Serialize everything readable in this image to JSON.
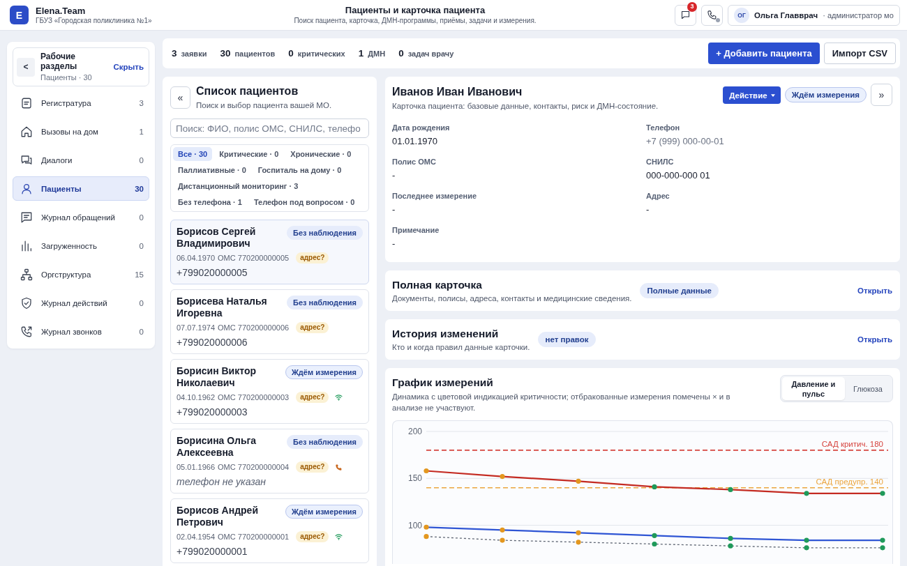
{
  "header": {
    "logo": "E",
    "brand": "Elena.Team",
    "organization": "ГБУЗ «Городская поликлиника №1»",
    "title": "Пациенты и карточка пациента",
    "subtitle": "Поиск пациента, карточка, ДМН-программы, приёмы, задачи и измерения.",
    "messages_badge": "3",
    "telephony_online": false,
    "user": {
      "initials": "ОГ",
      "name": "Ольга Главврач",
      "role": "· администратор мо"
    }
  },
  "sidebar": {
    "back_button": "<",
    "title": "Рабочие разделы",
    "subtitle": "Пациенты · 30",
    "hide_link": "Скрыть",
    "items": [
      {
        "label": "Регистратура",
        "count": "3",
        "selected": false
      },
      {
        "label": "Вызовы на дом",
        "count": "1",
        "selected": false
      },
      {
        "label": "Диалоги",
        "count": "0",
        "selected": false
      },
      {
        "label": "Пациенты",
        "count": "30",
        "selected": true
      },
      {
        "label": "Журнал обращений",
        "count": "0",
        "selected": false
      },
      {
        "label": "Загруженность",
        "count": "0",
        "selected": false
      },
      {
        "label": "Оргструктура",
        "count": "15",
        "selected": false
      },
      {
        "label": "Журнал действий",
        "count": "0",
        "selected": false
      },
      {
        "label": "Журнал звонков",
        "count": "0",
        "selected": false
      }
    ]
  },
  "stats": [
    {
      "count": "3",
      "label": "заявки"
    },
    {
      "count": "30",
      "label": "пациентов"
    },
    {
      "count": "0",
      "label": "критических"
    },
    {
      "count": "1",
      "label": "ДМН"
    },
    {
      "count": "0",
      "label": "задач врачу"
    }
  ],
  "actions": {
    "add_button": "+ Добавить пациента",
    "import_button": "Импорт CSV"
  },
  "patient_list": {
    "collapse_button": "«",
    "title": "Список пациентов",
    "subtitle": "Поиск и выбор пациента вашей МО.",
    "search": {
      "placeholder": "Поиск: ФИО, полис ОМС, СНИЛС, телефо"
    },
    "filters": [
      {
        "label": "Все · 30",
        "selected": true
      },
      {
        "label": "Критические · 0",
        "selected": false
      },
      {
        "label": "Хронические · 0",
        "selected": false
      },
      {
        "label": "Паллиативные · 0",
        "selected": false
      },
      {
        "label": "Госпиталь на дому · 0",
        "selected": false
      },
      {
        "label": "Дистанционный мониторинг · 3",
        "selected": false
      },
      {
        "label": "Без телефона · 1",
        "selected": false
      },
      {
        "label": "Телефон под вопросом · 0",
        "selected": false
      }
    ],
    "patients": [
      {
        "name": "Борисов Сергей Владимирович",
        "status": {
          "text": "Без наблюдения",
          "kind": "idle"
        },
        "birth_date": "06.04.1970",
        "policy": "ОМС 770200000005",
        "address_flag": "адрес?",
        "remote_monitoring": false,
        "phone_warning": false,
        "phone": "+799020000005",
        "phone_missing": false,
        "selected": true
      },
      {
        "name": "Борисева Наталья Игоревна",
        "status": {
          "text": "Без наблюдения",
          "kind": "idle"
        },
        "birth_date": "07.07.1974",
        "policy": "ОМС 770200000006",
        "address_flag": "адрес?",
        "remote_monitoring": false,
        "phone_warning": false,
        "phone": "+799020000006",
        "phone_missing": false,
        "selected": false
      },
      {
        "name": "Борисин Виктор Николаевич",
        "status": {
          "text": "Ждём измерения",
          "kind": "waiting"
        },
        "birth_date": "04.10.1962",
        "policy": "ОМС 770200000003",
        "address_flag": "адрес?",
        "remote_monitoring": true,
        "phone_warning": false,
        "phone": "+799020000003",
        "phone_missing": false,
        "selected": false
      },
      {
        "name": "Борисина Ольга Алексеевна",
        "status": {
          "text": "Без наблюдения",
          "kind": "idle"
        },
        "birth_date": "05.01.1966",
        "policy": "ОМС 770200000004",
        "address_flag": "адрес?",
        "remote_monitoring": false,
        "phone_warning": true,
        "phone": "телефон не указан",
        "phone_missing": true,
        "selected": false
      },
      {
        "name": "Борисов Андрей Петрович",
        "status": {
          "text": "Ждём измерения",
          "kind": "waiting"
        },
        "birth_date": "02.04.1954",
        "policy": "ОМС 770200000001",
        "address_flag": "адрес?",
        "remote_monitoring": true,
        "phone_warning": false,
        "phone": "+799020000001",
        "phone_missing": false,
        "selected": false
      }
    ]
  },
  "patient_card": {
    "name": "Иванов Иван Иванович",
    "subtitle": "Карточка пациента: базовые данные, контакты, риск и ДМН-состояние.",
    "action_button": "Действие",
    "status": {
      "text": "Ждём измерения",
      "kind": "waiting"
    },
    "expand_button": "»",
    "fields": [
      {
        "label": "Дата рождения",
        "value": "01.01.1970",
        "muted": false
      },
      {
        "label": "Телефон",
        "value": "+7 (999) 000-00-01",
        "muted": true
      },
      {
        "label": "Полис ОМС",
        "value": "-",
        "muted": false
      },
      {
        "label": "СНИЛС",
        "value": "000-000-000 01",
        "muted": false
      },
      {
        "label": "Последнее измерение",
        "value": "-",
        "muted": false
      },
      {
        "label": "Адрес",
        "value": "-",
        "muted": false
      },
      {
        "label": "Примечание",
        "value": "-",
        "muted": false
      }
    ]
  },
  "sections": [
    {
      "title": "Полная карточка",
      "subtitle": "Документы, полисы, адреса, контакты и медицинские сведения.",
      "badge": "Полные данные",
      "link": "Открыть"
    },
    {
      "title": "История изменений",
      "subtitle": "Кто и когда правил данные карточки.",
      "badge": "нет правок",
      "link": "Открыть"
    }
  ],
  "measurements": {
    "title": "График измерений",
    "subtitle": "Динамика с цветовой индикацией критичности; отбракованные измерения помечены × и в анализе не участвуют.",
    "tabs": [
      {
        "label": "Давление и пульс",
        "selected": true
      },
      {
        "label": "Глюкоза",
        "selected": false
      }
    ],
    "point_alerts": [
      [
        true,
        true,
        true,
        false,
        false,
        false,
        false
      ],
      [
        true,
        true,
        true,
        false,
        false,
        false,
        false
      ],
      [
        true,
        true,
        true,
        false,
        false,
        false,
        false
      ]
    ],
    "chart_data": {
      "type": "line",
      "ylim": [
        60,
        200
      ],
      "yticks": [
        100,
        150,
        200
      ],
      "series": [
        {
          "color": "#c42b22",
          "marker": "circle",
          "values": [
            158,
            152,
            147,
            141,
            138,
            134,
            134
          ]
        },
        {
          "color": "#2f55d4",
          "marker": "circle",
          "values": [
            98,
            95,
            92,
            89,
            86,
            84,
            84
          ]
        },
        {
          "color": "#5f6673",
          "line_style": "dashed",
          "marker": "circle",
          "values": [
            88,
            84,
            82,
            80,
            78,
            76,
            76
          ]
        }
      ],
      "ref_lines": [
        {
          "axis": "y",
          "value": 180,
          "label": "САД критич. 180",
          "color": "#d6453f",
          "line_style": "dashed"
        },
        {
          "axis": "y",
          "value": 140,
          "label": "САД предупр. 140",
          "color": "#eba53e",
          "line_style": "dashed"
        }
      ]
    }
  }
}
